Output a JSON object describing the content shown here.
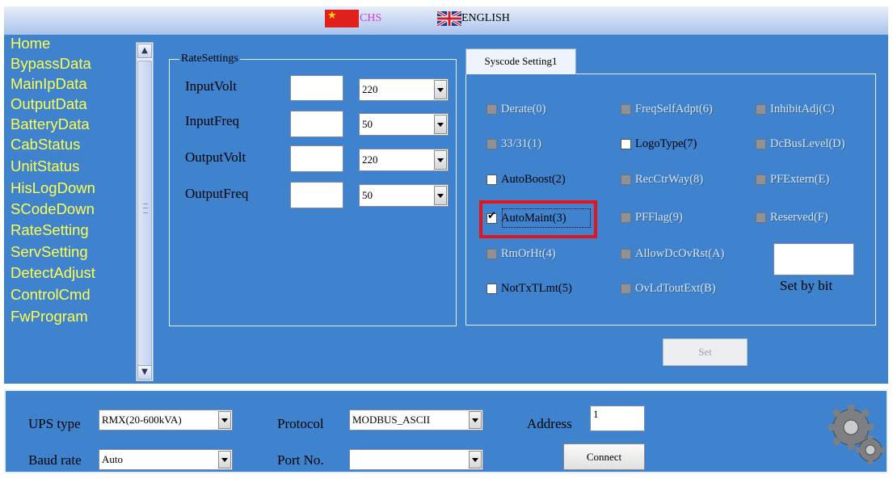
{
  "header": {
    "lang_chs": "CHS",
    "lang_english": "ENGLISH"
  },
  "sidebar": {
    "items": [
      "Home",
      "BypassData",
      "MainIpData",
      "OutputData",
      "BatteryData",
      "CabStatus",
      "UnitStatus",
      "HisLogDown",
      "SCodeDown",
      "RateSetting",
      "ServSetting",
      "DetectAdjust",
      "ControlCmd",
      "FwProgram"
    ]
  },
  "rate_settings": {
    "title": "RateSettings",
    "rows": [
      {
        "label": "InputVolt",
        "value": "",
        "selected": "220"
      },
      {
        "label": "InputFreq",
        "value": "",
        "selected": "50"
      },
      {
        "label": "OutputVolt",
        "value": "",
        "selected": "220"
      },
      {
        "label": "OutputFreq",
        "value": "",
        "selected": "50"
      }
    ]
  },
  "syscode": {
    "tab_label": "Syscode Setting1",
    "col1": [
      {
        "label": "Derate(0)",
        "enabled": false,
        "checked": false
      },
      {
        "label": "33/31(1)",
        "enabled": false,
        "checked": false
      },
      {
        "label": "AutoBoost(2)",
        "enabled": true,
        "checked": false
      },
      {
        "label": "AutoMaint(3)",
        "enabled": true,
        "checked": true
      },
      {
        "label": "RmOrHt(4)",
        "enabled": false,
        "checked": false
      },
      {
        "label": "NotTxTLmt(5)",
        "enabled": true,
        "checked": false
      }
    ],
    "col2": [
      {
        "label": "FreqSelfAdpt(6)",
        "enabled": false,
        "checked": false
      },
      {
        "label": "LogoType(7)",
        "enabled": true,
        "checked": false
      },
      {
        "label": "RecCtrWay(8)",
        "enabled": false,
        "checked": false
      },
      {
        "label": "PFFlag(9)",
        "enabled": false,
        "checked": false
      },
      {
        "label": "AllowDcOvRst(A)",
        "enabled": false,
        "checked": false
      },
      {
        "label": "OvLdToutExt(B)",
        "enabled": false,
        "checked": false
      }
    ],
    "col3": [
      {
        "label": "InhibitAdj(C)",
        "enabled": false,
        "checked": false
      },
      {
        "label": "DcBusLevel(D)",
        "enabled": false,
        "checked": false
      },
      {
        "label": "PFExtern(E)",
        "enabled": false,
        "checked": false
      },
      {
        "label": "Reserved(F)",
        "enabled": false,
        "checked": false
      }
    ],
    "bit_value": "",
    "set_by_bit_label": "Set by bit",
    "set_button": "Set"
  },
  "connection": {
    "ups_type_label": "UPS type",
    "ups_type_value": "RMX(20-600kVA)",
    "protocol_label": "Protocol",
    "protocol_value": "MODBUS_ASCII",
    "address_label": "Address",
    "address_value": "1",
    "baud_rate_label": "Baud rate",
    "baud_rate_value": "Auto",
    "port_label": "Port No.",
    "port_value": "",
    "connect_button": "Connect"
  }
}
